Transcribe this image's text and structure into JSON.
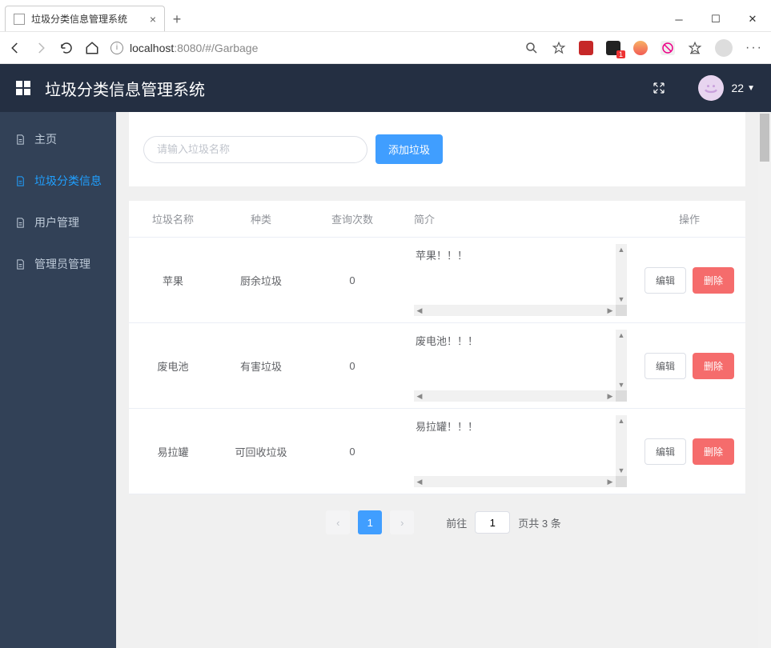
{
  "browser": {
    "tab_title": "垃圾分类信息管理系统",
    "url_host": "localhost",
    "url_port": ":8080",
    "url_path": "/#/Garbage",
    "ext_badge": "1"
  },
  "header": {
    "app_title": "垃圾分类信息管理系统",
    "user_badge": "22"
  },
  "sidebar": {
    "items": [
      {
        "label": "主页"
      },
      {
        "label": "垃圾分类信息"
      },
      {
        "label": "用户管理"
      },
      {
        "label": "管理员管理"
      }
    ]
  },
  "toolbar": {
    "search_placeholder": "请输入垃圾名称",
    "add_label": "添加垃圾"
  },
  "table": {
    "headers": {
      "name": "垃圾名称",
      "type": "种类",
      "count": "查询次数",
      "desc": "简介",
      "ops": "操作"
    },
    "ops": {
      "edit": "编辑",
      "delete": "删除"
    },
    "rows": [
      {
        "name": "苹果",
        "type": "厨余垃圾",
        "count": "0",
        "desc": "苹果！！！"
      },
      {
        "name": "废电池",
        "type": "有害垃圾",
        "count": "0",
        "desc": "废电池！！！"
      },
      {
        "name": "易拉罐",
        "type": "可回收垃圾",
        "count": "0",
        "desc": "易拉罐！！！"
      }
    ]
  },
  "pager": {
    "current": "1",
    "goto_prefix": "前往",
    "goto_value": "1",
    "total_text": "页共 3 条"
  }
}
